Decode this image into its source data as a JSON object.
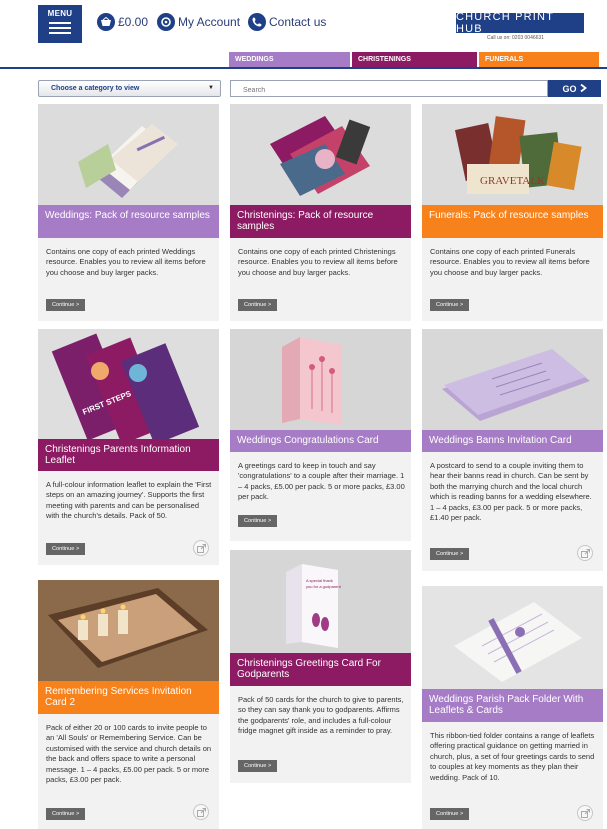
{
  "header": {
    "menu_label": "MENU",
    "basket_total": "£0.00",
    "account_label": "My Account",
    "contact_label": "Contact us",
    "brand_name": "CHURCH PRINT HUB",
    "brand_phone": "Call us on: 0203 0046631"
  },
  "tabs": [
    {
      "label": "WEDDINGS",
      "color": "#a77cc7"
    },
    {
      "label": "CHRISTENINGS",
      "color": "#8d1b63"
    },
    {
      "label": "FUNERALS",
      "color": "#f7821b"
    }
  ],
  "filters": {
    "category_value": "Choose a category to view",
    "search_placeholder": "Search",
    "go_label": "GO"
  },
  "colors": {
    "navy": "#1f3f86",
    "weddings": "#a77cc7",
    "christenings": "#8d1b63",
    "funerals": "#f7821b"
  },
  "products": [
    {
      "title": "Weddings: Pack of resource samples",
      "category": "weddings",
      "description": "Contains one copy of each printed Weddings resource. Enables you to review all items before you choose and buy larger packs.",
      "button": "Continue >",
      "icon": "wedding-samples-image"
    },
    {
      "title": "Christenings: Pack of resource samples",
      "category": "christenings",
      "description": "Contains one copy of each printed Christenings resource. Enables you to review all items before you choose and buy larger packs.",
      "button": "Continue >",
      "icon": "christening-samples-image"
    },
    {
      "title": "Funerals: Pack of resource samples",
      "category": "funerals",
      "description": "Contains one copy of each printed Funerals resource. Enables you to review all items before you choose and buy larger packs.",
      "button": "Continue >",
      "icon": "funeral-samples-image"
    },
    {
      "title": "Christenings Parents Information Leaflet",
      "category": "christenings",
      "description": "A full-colour information leaflet to explain the 'First steps on an amazing journey'. Supports the first meeting with parents and can be personalised with the church's details. Pack of 50.",
      "button": "Continue >",
      "icon": "leaflet-image"
    },
    {
      "title": "Weddings Congratulations Card",
      "category": "weddings",
      "description": "A greetings card to keep in touch and say 'congratulations' to a couple after their marriage. 1 – 4 packs, £5.00 per pack. 5 or more packs, £3.00 per pack.",
      "button": "Continue >",
      "icon": "card-image"
    },
    {
      "title": "Weddings Banns Invitation Card",
      "category": "weddings",
      "description": "A postcard to send to a couple inviting them to hear their banns read in church. Can be sent by both the marrying church and the local church which is reading banns for a wedding elsewhere. 1 – 4 packs, £3.00 per pack. 5 or more packs, £1.40 per pack.",
      "button": "Continue >",
      "icon": "postcard-image"
    },
    {
      "title": "Remembering Services Invitation Card 2",
      "category": "funerals",
      "description": "Pack of either 20 or 100 cards to invite people to an 'All Souls' or Remembering Service. Can be customised with the service and church details on the back and offers space to write a personal message. 1 – 4 packs, £5.00 per pack. 5 or more packs, £3.00 per pack.",
      "button": "Continue >",
      "icon": "candles-image"
    },
    {
      "title": "Christenings Greetings Card For Godparents",
      "category": "christenings",
      "description": "Pack of 50 cards for the church to give to parents, so they can say thank you to godparents. Affirms the godparents' role, and includes a full-colour fridge magnet gift inside as a reminder to pray.",
      "button": "Continue >",
      "icon": "godparents-card-image"
    },
    {
      "title": "Weddings Parish Pack Folder With Leaflets & Cards",
      "category": "weddings",
      "description": "This ribbon-tied folder contains a range of leaflets offering practical guidance on getting married in church, plus, a set of four greetings cards to send to couples at key moments as they plan their wedding. Pack of 10.",
      "button": "Continue >",
      "icon": "folder-image"
    }
  ]
}
